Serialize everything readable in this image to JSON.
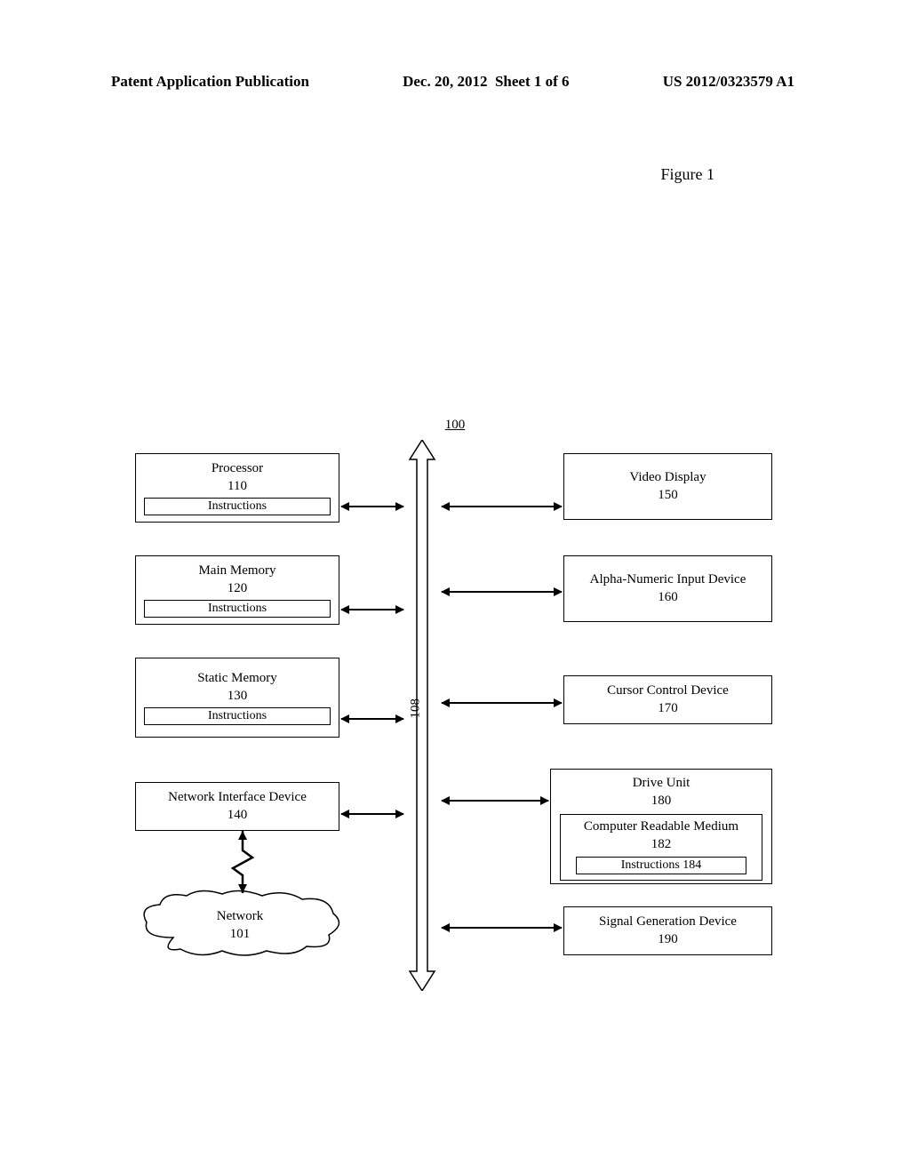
{
  "header": {
    "publication": "Patent Application Publication",
    "date": "Dec. 20, 2012",
    "sheet": "Sheet 1 of 6",
    "patent_number": "US 2012/0323579 A1"
  },
  "figure_label": "Figure 1",
  "diagram": {
    "system_label": "100",
    "bus_label": "108",
    "blocks": {
      "processor": {
        "title": "Processor",
        "num": "110",
        "instructions": "Instructions"
      },
      "main_memory": {
        "title": "Main Memory",
        "num": "120",
        "instructions": "Instructions"
      },
      "static_memory": {
        "title": "Static Memory",
        "num": "130",
        "instructions": "Instructions"
      },
      "network_interface": {
        "title": "Network Interface Device",
        "num": "140"
      },
      "video_display": {
        "title": "Video Display",
        "num": "150"
      },
      "alpha_numeric": {
        "title": "Alpha-Numeric Input Device",
        "num": "160"
      },
      "cursor_control": {
        "title": "Cursor Control Device",
        "num": "170"
      },
      "drive_unit": {
        "title": "Drive Unit",
        "num": "180"
      },
      "medium": {
        "title": "Computer Readable Medium",
        "num": "182"
      },
      "instructions_184": "Instructions 184",
      "signal_gen": {
        "title": "Signal Generation Device",
        "num": "190"
      },
      "network": {
        "title": "Network",
        "num": "101"
      }
    }
  }
}
